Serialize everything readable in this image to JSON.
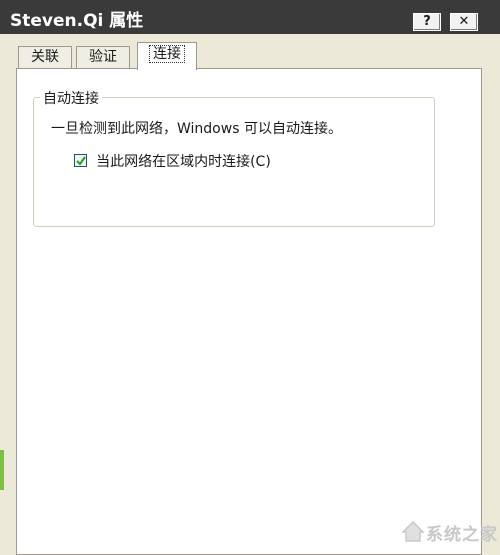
{
  "window": {
    "title": "Steven.Qi 属性",
    "help_label": "?",
    "close_label": "✕"
  },
  "tabs": [
    {
      "label": "关联",
      "selected": false
    },
    {
      "label": "验证",
      "selected": false
    },
    {
      "label": "连接",
      "selected": true
    }
  ],
  "group": {
    "title": "自动连接",
    "description": "一旦检测到此网络，Windows 可以自动连接。",
    "checkbox": {
      "label": "当此网络在区域内时连接(C)",
      "checked": true
    }
  },
  "watermark": {
    "text": "系统之家",
    "icon": "house-logo-icon"
  },
  "colors": {
    "titlebar": "#3a3a3a",
    "panel": "#ffffff",
    "window_bg": "#ece9d8"
  }
}
